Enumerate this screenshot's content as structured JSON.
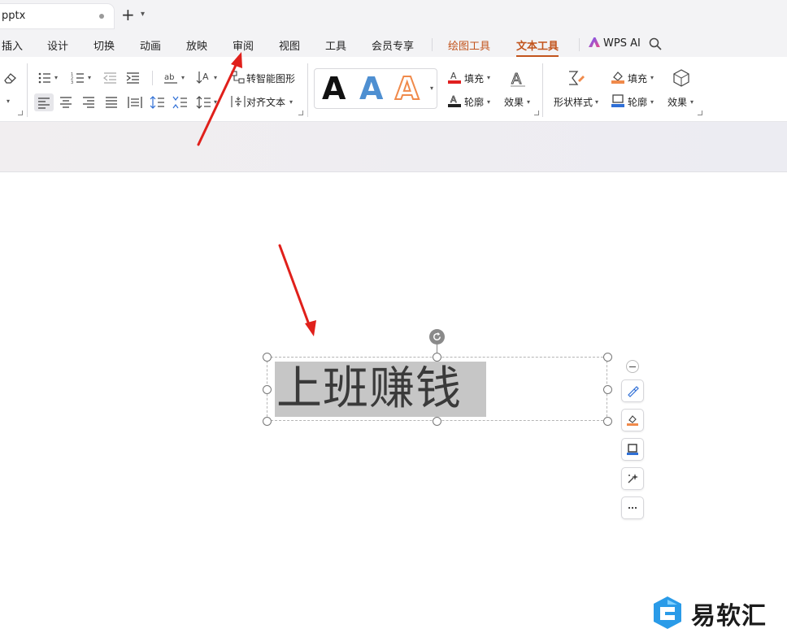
{
  "titlebar": {
    "doc_tab_title": "pptx"
  },
  "menu": {
    "items": [
      "插入",
      "设计",
      "切换",
      "动画",
      "放映",
      "审阅",
      "视图",
      "工具",
      "会员专享"
    ],
    "context_tabs": [
      "绘图工具",
      "文本工具"
    ],
    "active": "文本工具",
    "ai_label": "WPS AI"
  },
  "ribbon": {
    "smart_shape": "转智能图形",
    "align_text": "对齐文本",
    "wordart_letters": [
      "A",
      "A",
      "A"
    ],
    "text_fill": "填充",
    "text_outline": "轮廓",
    "text_effects": "效果",
    "shape_style": "形状样式",
    "shape_fill": "填充",
    "shape_outline": "轮廓",
    "shape_effects": "效果",
    "line_spacing_icon": "ab"
  },
  "canvas": {
    "textbox_text": "上班赚钱"
  },
  "watermark": {
    "text": "易软汇"
  },
  "colors": {
    "accent": "#c2541d",
    "arrow": "#e0201b",
    "fill_red": "#e02020",
    "outline_blue": "#2f6fd6"
  }
}
